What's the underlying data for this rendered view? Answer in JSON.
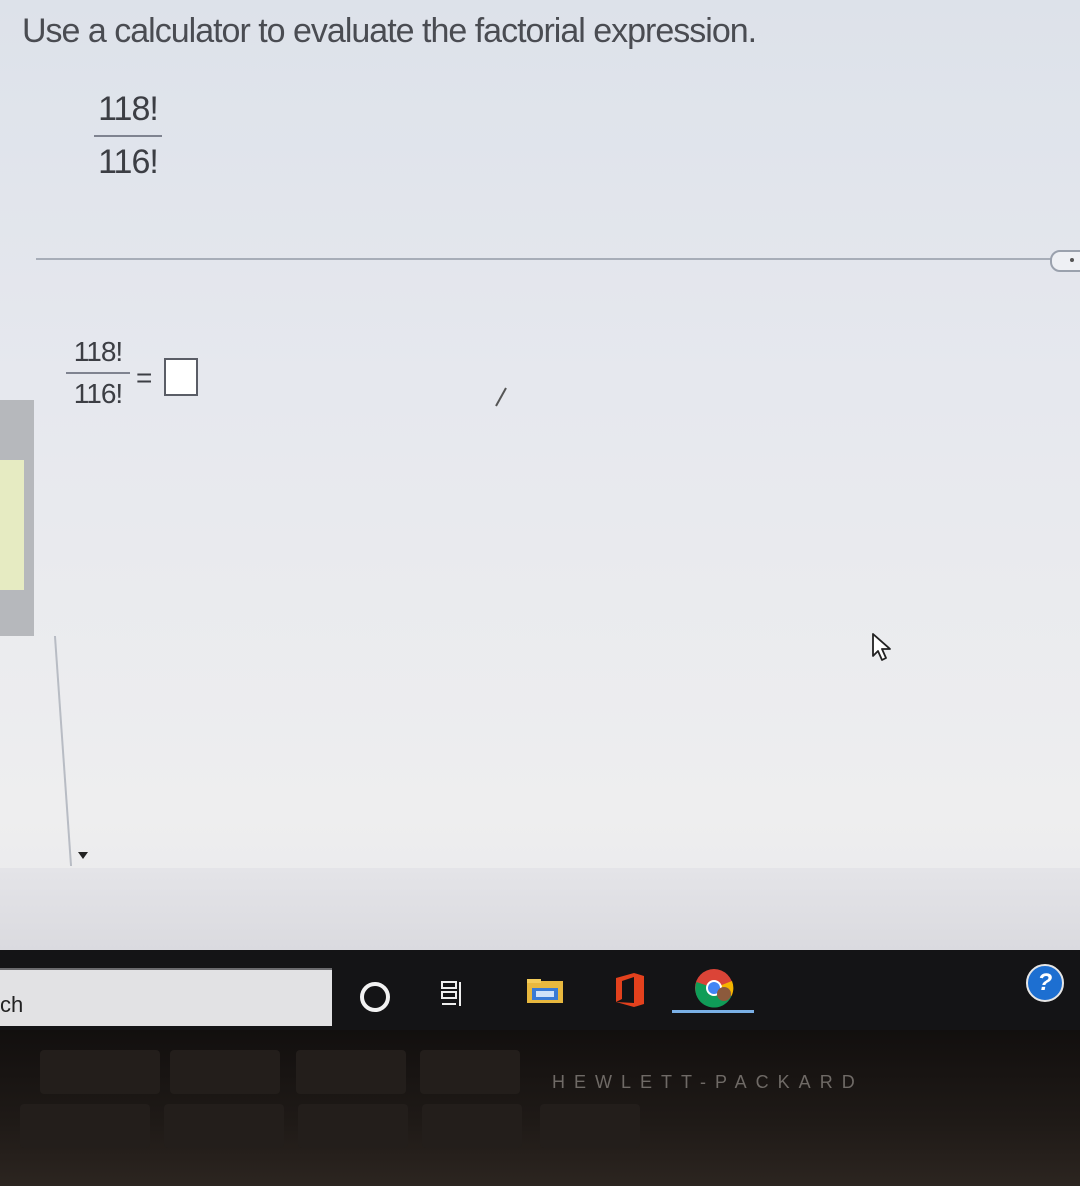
{
  "question": {
    "prompt": "Use a calculator to evaluate the factorial expression.",
    "expression": {
      "numerator": "118!",
      "denominator": "116!"
    }
  },
  "answer": {
    "numerator": "118!",
    "denominator": "116!",
    "equals": "=",
    "value": ""
  },
  "taskbar": {
    "search_label": "ch",
    "icons": [
      "cortana-icon",
      "task-view-icon",
      "file-explorer-icon",
      "office-icon",
      "chrome-icon",
      "help-icon"
    ],
    "help_glyph": "?"
  },
  "laptop": {
    "brand": "HEWLETT-PACKARD"
  }
}
